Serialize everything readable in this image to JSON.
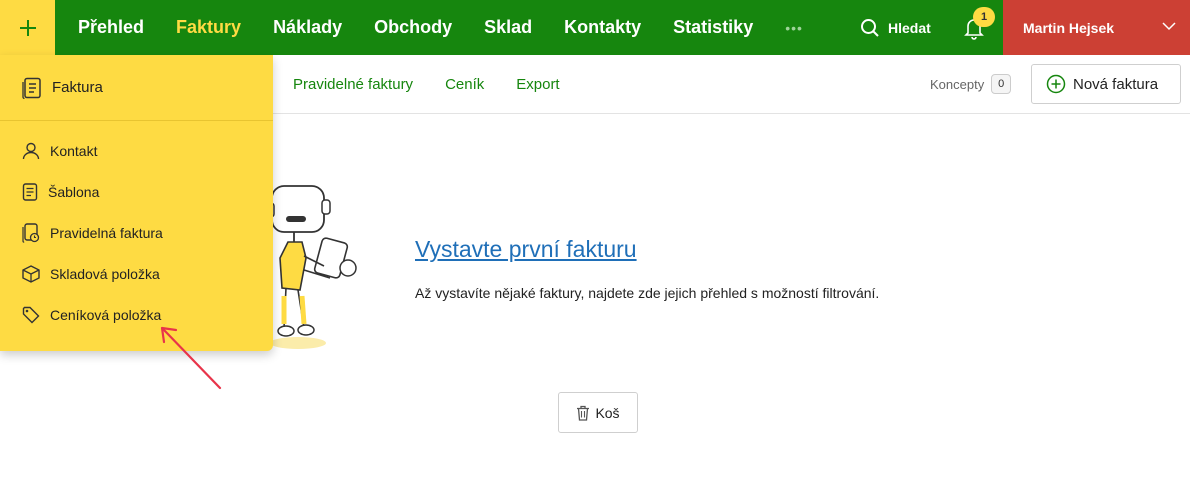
{
  "topbar": {
    "nav": [
      "Přehled",
      "Faktury",
      "Náklady",
      "Obchody",
      "Sklad",
      "Kontakty",
      "Statistiky"
    ],
    "active_index": 1,
    "more": "•••",
    "search_label": "Hledat",
    "notifications_count": "1",
    "user_name": "Martin Hejsek"
  },
  "subnav": {
    "tabs": [
      "Pravidelné faktury",
      "Ceník",
      "Export"
    ],
    "concepts_label": "Koncepty",
    "concepts_count": "0",
    "new_invoice_label": "Nová faktura"
  },
  "dropdown": {
    "header": "Faktura",
    "items": [
      "Kontakt",
      "Šablona",
      "Pravidelná faktura",
      "Skladová položka",
      "Ceníková položka"
    ]
  },
  "empty_state": {
    "title": "Vystavte první fakturu",
    "text": "Až vystavíte nějaké faktury, najdete zde jejich přehled s možností filtrování.",
    "trash_label": "Koš"
  },
  "colors": {
    "nav_green": "#16860e",
    "accent_yellow": "#fedb43",
    "user_red": "#cc4034",
    "link_blue": "#1f6fb8",
    "annotation_arrow": "#e8344a"
  }
}
